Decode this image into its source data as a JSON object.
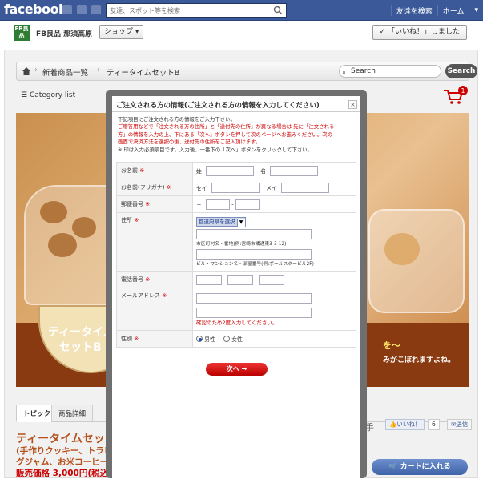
{
  "facebook": {
    "logo": "facebook",
    "search_placeholder": "友達、スポット等を検索",
    "find_friends": "友達を検索",
    "home": "ホーム"
  },
  "page_header": {
    "badge": "FB良品",
    "page_name": "FB良品 那須高原",
    "shop_label": "ショップ ▾",
    "like_label": "✓ 「いいね！」しました"
  },
  "store": {
    "breadcrumb": [
      "新着商品一覧",
      "ティータイムセットB"
    ],
    "search_placeholder": "Search",
    "search_button": "Search",
    "category_list": "Category list",
    "cart_count": "1",
    "hero": {
      "title_line1": "ティータイム",
      "title_line2": "セットB",
      "right_line1": "を～",
      "right_line2": "みがこぼれますよね。"
    },
    "tabs": [
      "トピック",
      "商品詳細"
    ],
    "like_small": "いいね！",
    "like_count": "6",
    "send": "送信",
    "hand_hint": "手",
    "product_title": "ティータイムセッ",
    "product_sub1": "(手作りクッキー、トラピス",
    "product_sub2": "グジャム、お米コーヒー",
    "product_price": "販売価格 3,000円(税込",
    "cart_button": "カートに入れる"
  },
  "modal": {
    "title": "ご注文される方の情報(ご注文される方の情報を入力してください)",
    "close": "×",
    "intro_line1": "下記項目にご注文される方の情報をご入力下さい。",
    "intro_line2": "ご贈答用などで「注文される方の住所」と「送付先の住所」が異なる場合は 先に「注文される",
    "intro_line3": "方」の情報を入力の上、下にある「次へ」ボタンを押して次のページへお進みください。次の",
    "intro_line4": "画面で決済方法を選択の後、送付先の住所をご記入頂けます。",
    "intro_line5": "※ 印は入力必須項目です。入力後、一番下の「次へ」ボタンをクリックして下さい。",
    "required_mark": "※",
    "fields": {
      "name_label": "お名前",
      "last_name": "姓",
      "first_name": "名",
      "kana_label": "お名前(フリガナ)",
      "kana_last": "セイ",
      "kana_first": "メイ",
      "zip_label": "郵便番号",
      "zip_mark": "〒",
      "zip_dash": "-",
      "address_label": "住所",
      "pref_select": "都道府県を選択",
      "city_note": "市区町村名・番地(例:宮崎市橘通東3-3-12)",
      "building_note": "ビル・マンション名・部屋番号(例:ボールスタービル2F)",
      "phone_label": "電話番号",
      "phone_dash": "-",
      "email_label": "メールアドレス",
      "email_confirm_note": "確認のため2度入力してください。",
      "gender_label": "性別",
      "male": "男性",
      "female": "女性"
    },
    "next_button": "次へ →"
  },
  "colors": {
    "facebook_blue": "#3b5998",
    "required_red": "#cc0000",
    "next_button": "#d80000",
    "product_title": "#b5501a"
  }
}
